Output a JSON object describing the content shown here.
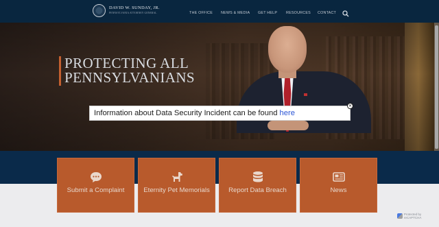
{
  "header": {
    "logo": {
      "name": "DAVID W. SUNDAY, JR.",
      "subtitle": "PENNSYLVANIA ATTORNEY GENERAL"
    },
    "nav": [
      "THE OFFICE",
      "NEWS & MEDIA",
      "GET HELP",
      "RESOURCES",
      "CONTACT"
    ],
    "search_icon": "search-icon"
  },
  "hero": {
    "title_line1": "PROTECTING ALL",
    "title_line2": "PENNSYLVANIANS"
  },
  "modal": {
    "text": "Information about Data Security Incident can be found ",
    "link": "here",
    "close_icon": "close-icon"
  },
  "cards": [
    {
      "label": "Submit a Complaint",
      "icon": "chat-bubble-icon"
    },
    {
      "label": "Eternity Pet Memorials",
      "icon": "dog-icon"
    },
    {
      "label": "Report Data Breach",
      "icon": "database-icon"
    },
    {
      "label": "News",
      "icon": "newspaper-icon"
    }
  ],
  "recaptcha": {
    "text": "Protected by reCAPTCHA"
  },
  "colors": {
    "header_bg": "#09263f",
    "band_bg": "#0a2a4a",
    "card_bg": "#b85a2c",
    "accent": "#c46030",
    "link": "#2b55d6"
  }
}
